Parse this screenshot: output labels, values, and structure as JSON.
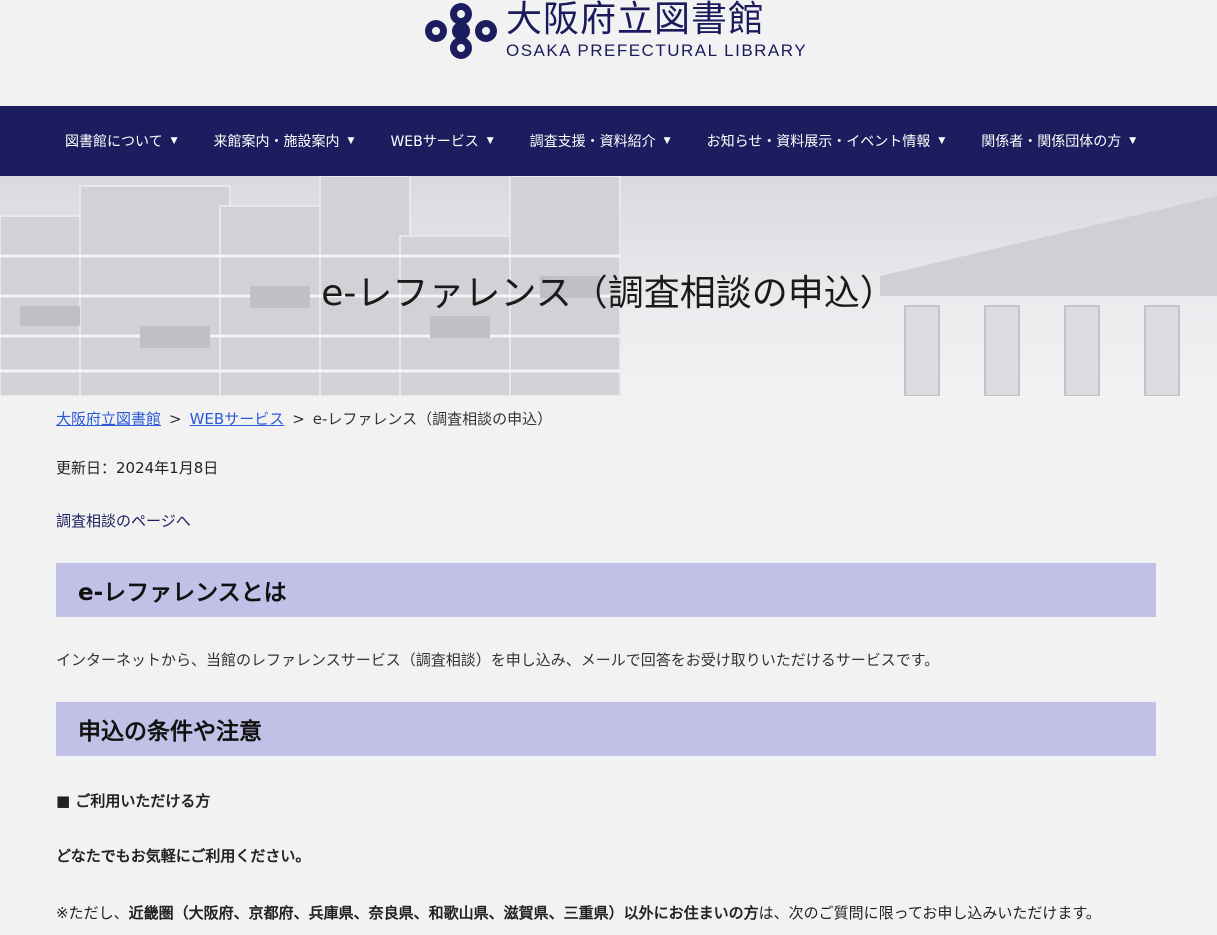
{
  "header": {
    "logo_jp": "大阪府立図書館",
    "logo_en": "OSAKA PREFECTURAL LIBRARY",
    "brand_color": "#1b1d5e"
  },
  "nav": {
    "items": [
      {
        "label": "図書館について"
      },
      {
        "label": "来館案内・施設案内"
      },
      {
        "label": "WEBサービス"
      },
      {
        "label": "調査支援・資料紹介"
      },
      {
        "label": "お知らせ・資料展示・イベント情報"
      },
      {
        "label": "関係者・関係団体の方"
      }
    ],
    "caret": "▼"
  },
  "hero": {
    "title": "e-レファレンス（調査相談の申込）"
  },
  "breadcrumb": {
    "home": "大阪府立図書館",
    "sep": ">",
    "section": "WEBサービス",
    "current": "e-レファレンス（調査相談の申込）"
  },
  "page": {
    "updated": "更新日：2024年1月8日",
    "consult_link": "調査相談のページへ",
    "heading1": "e-レファレンスとは",
    "intro": "インターネットから、当館のレファレンスサービス（調査相談）を申し込み、メールで回答をお受け取りいただけるサービスです。",
    "heading2": "申込の条件や注意",
    "subhead": "■ ご利用いただける方",
    "anyone": "どなたでもお気軽にご利用ください。",
    "note_prefix": "※ただし、",
    "note_bold": "近畿圏（大阪府、京都府、兵庫県、奈良県、和歌山県、滋賀県、三重県）以外にお住まいの方",
    "note_suffix": "は、次のご質問に限ってお申し込みいただけます。",
    "heading_bg": "#c1c1e8",
    "link_color": "#2a5ad8"
  }
}
